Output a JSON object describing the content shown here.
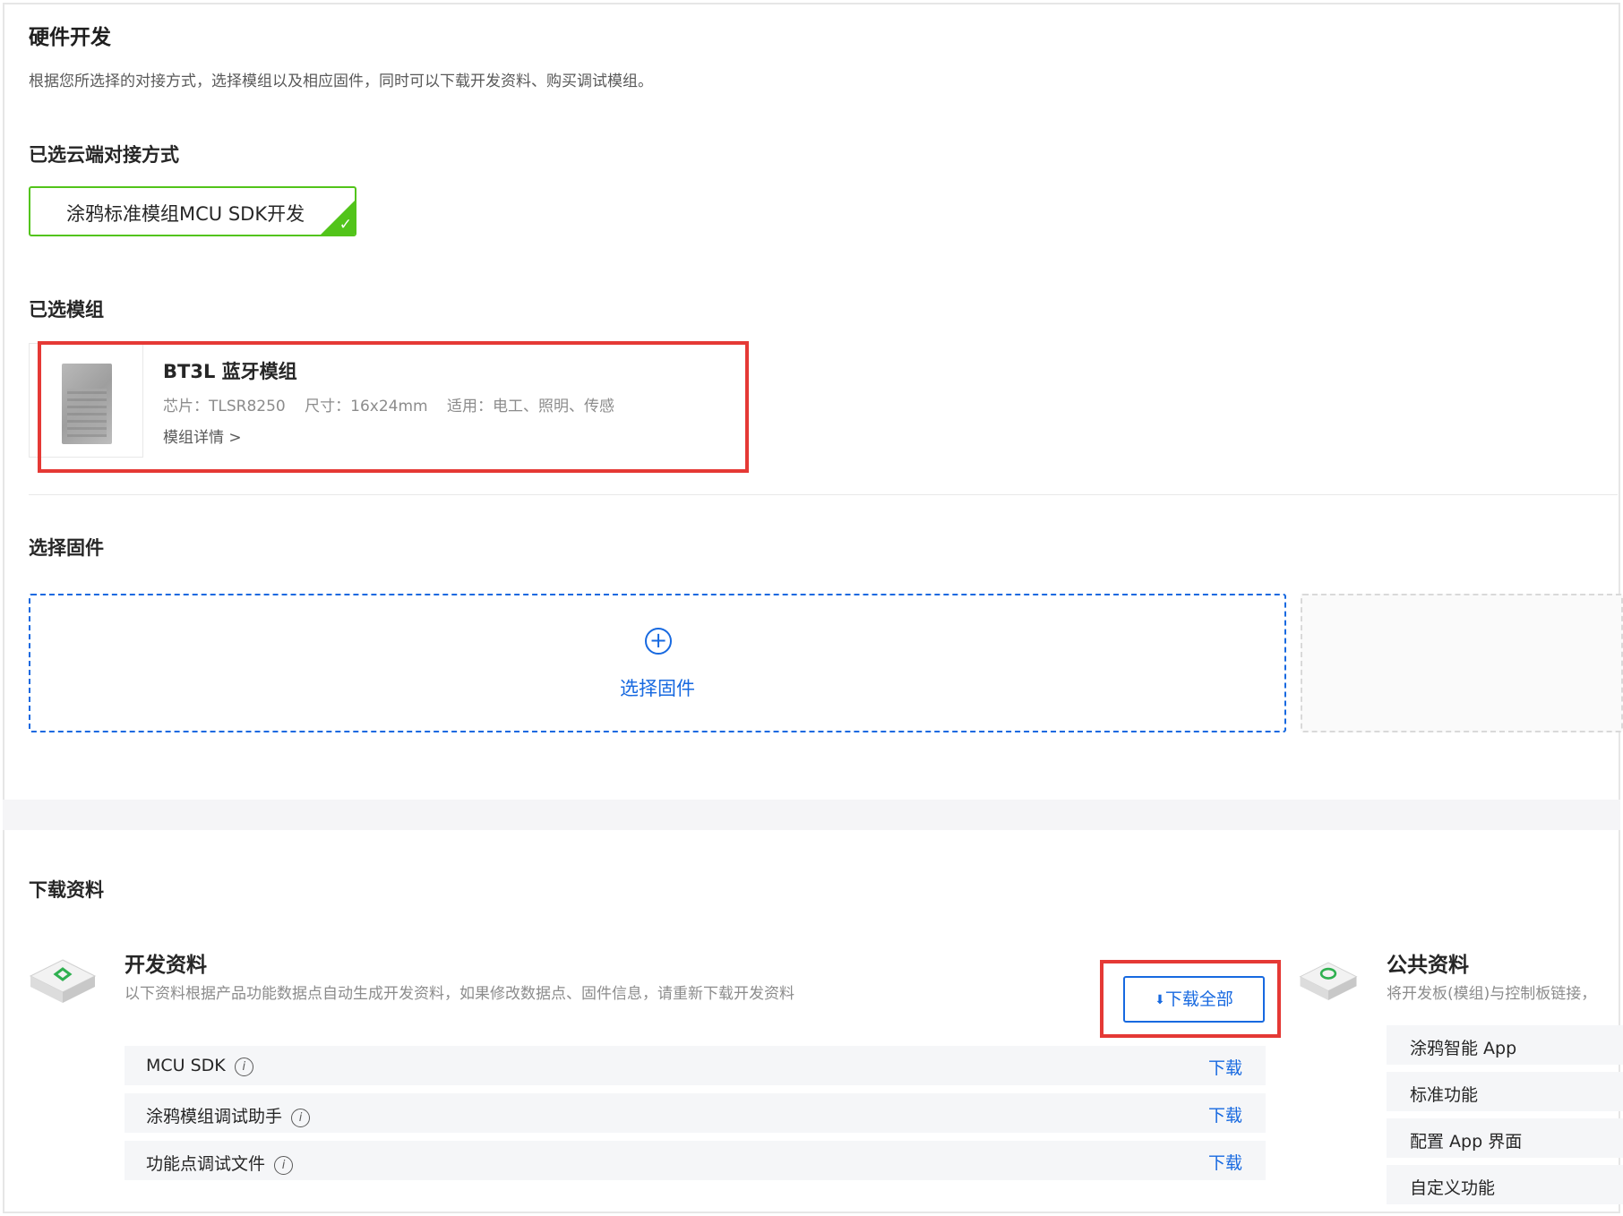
{
  "header": {
    "title": "硬件开发",
    "description": "根据您所选择的对接方式，选择模组以及相应固件，同时可以下载开发资料、购买调试模组。"
  },
  "cloud": {
    "section_title": "已选云端对接方式",
    "selected_label": "涂鸦标准模组MCU SDK开发",
    "check": "✓"
  },
  "module": {
    "section_title": "已选模组",
    "name": "BT3L 蓝牙模组",
    "chip": "芯片：TLSR8250",
    "size": "尺寸：16x24mm",
    "usage": "适用：电工、照明、传感",
    "details_link": "模组详情 >"
  },
  "firmware": {
    "section_title": "选择固件",
    "add_label": "选择固件",
    "plus": "+"
  },
  "downloads": {
    "section_title": "下载资料",
    "dev": {
      "title": "开发资料",
      "description": "以下资料根据产品功能数据点自动生成开发资料，如果修改数据点、固件信息，请重新下载开发资料",
      "download_all_label": "下载全部",
      "download_all_icon": "⬇",
      "items": [
        {
          "name": "MCU SDK",
          "info": "i",
          "action": "下载"
        },
        {
          "name": "涂鸦模组调试助手",
          "info": "i",
          "action": "下载"
        },
        {
          "name": "功能点调试文件",
          "info": "i",
          "action": "下载"
        }
      ]
    },
    "public": {
      "title": "公共资料",
      "description": "将开发板(模组)与控制板链接，",
      "items": [
        "涂鸦智能 App",
        "标准功能",
        "配置 App 界面",
        "自定义功能"
      ]
    }
  },
  "colors": {
    "accent": "#1769e0",
    "success": "#52c41a",
    "highlight": "#e53935"
  }
}
